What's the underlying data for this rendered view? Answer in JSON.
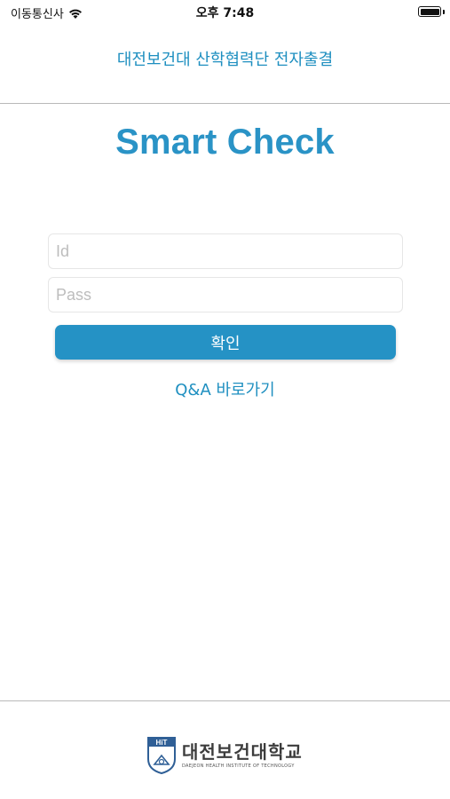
{
  "status_bar": {
    "carrier": "이동통신사",
    "time": "오후 7:48"
  },
  "nav": {
    "title": "대전보건대 산학협력단 전자출결"
  },
  "app_title": "Smart Check",
  "login": {
    "id_placeholder": "Id",
    "id_value": "",
    "pass_placeholder": "Pass",
    "pass_value": "",
    "confirm_label": "확인",
    "qa_link_label": "Q&A 바로가기"
  },
  "footer": {
    "logo_badge": "HiT",
    "logo_name": "대전보건대학교",
    "logo_subtitle": "DAEJEON HEALTH INSTITUTE OF TECHNOLOGY"
  },
  "colors": {
    "accent": "#2592c5",
    "text_link": "#1e8fc0",
    "divider": "#b9b9b9"
  }
}
